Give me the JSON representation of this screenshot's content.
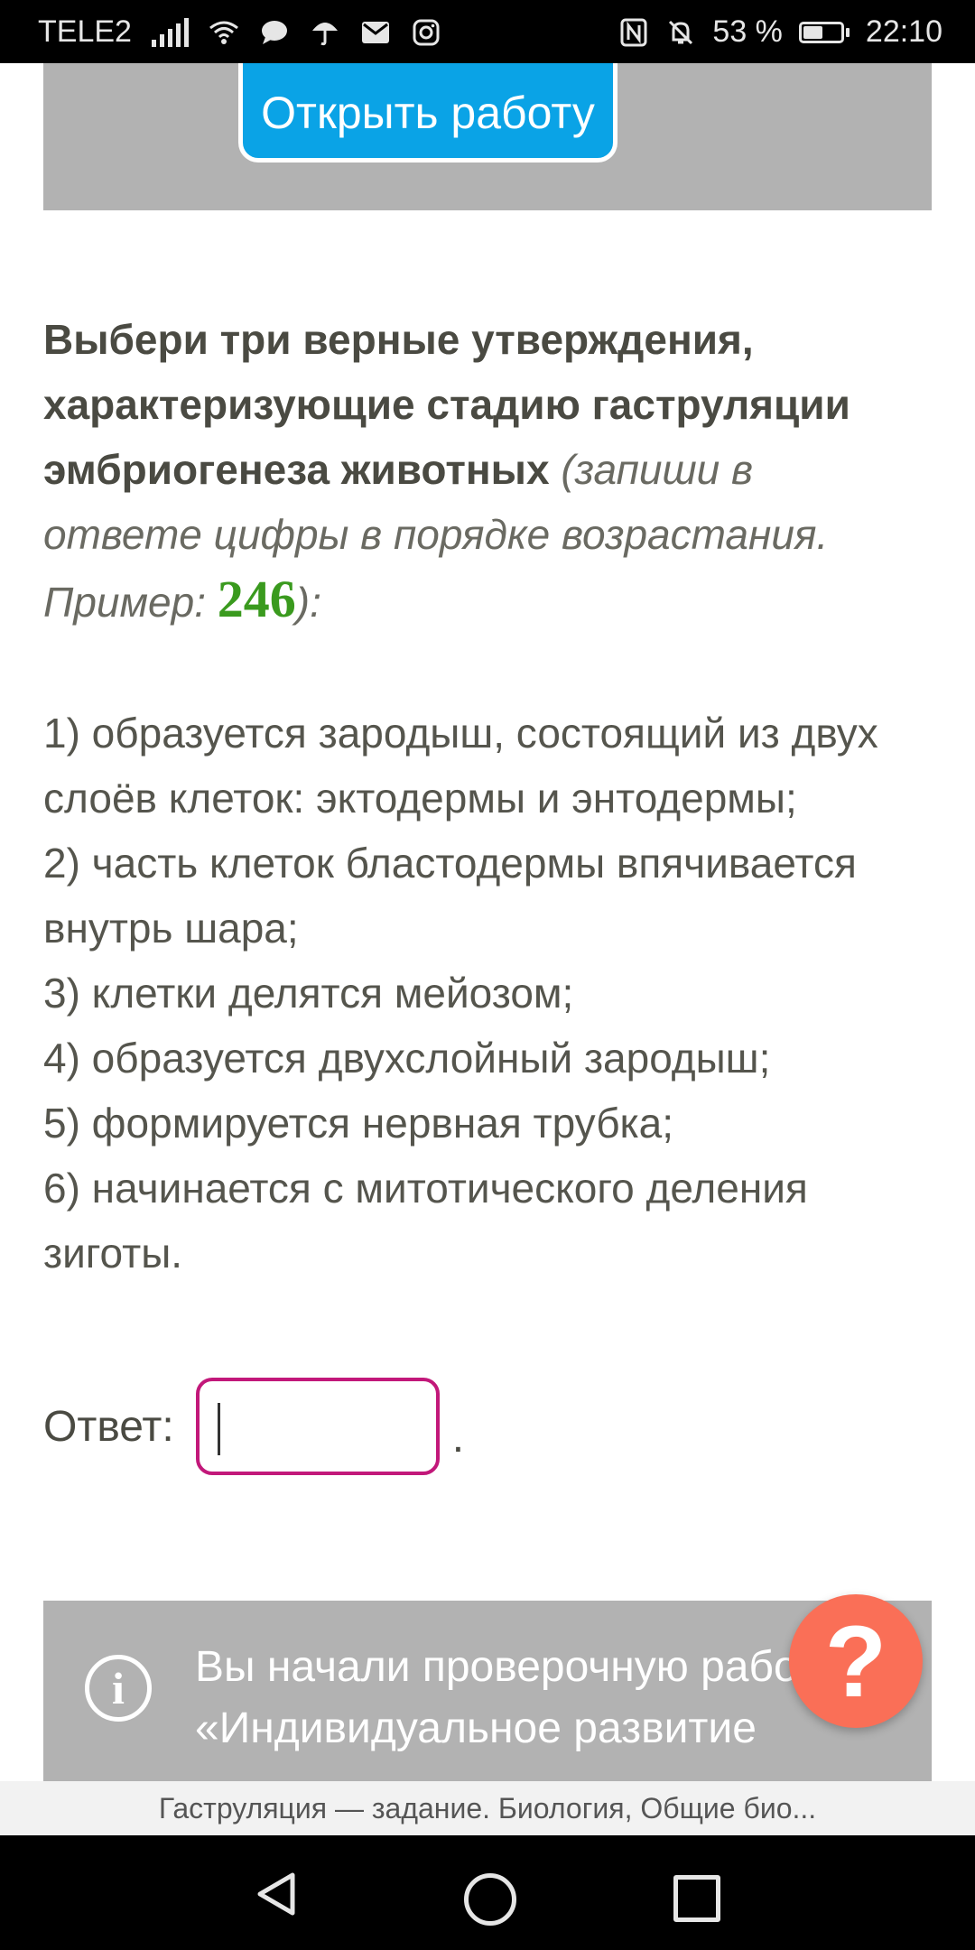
{
  "status_bar": {
    "carrier": "TELE2",
    "battery": "53 %",
    "battery_level": 0.53,
    "time": "22:10",
    "icons": [
      "signal-icon",
      "wifi-icon",
      "message-icon",
      "umbrella-icon",
      "mail-icon",
      "instagram-icon",
      "nfc-icon",
      "mute-icon",
      "battery-icon"
    ]
  },
  "top_banner": {
    "button_label": "Открыть работу"
  },
  "question": {
    "prompt": "Выбери три верные утверждения, характеризующие стадию гаструляции эмбриогенеза животных",
    "hint": "(запиши в ответе цифры в порядке возрастания. Пример: ",
    "example": "246",
    "closing": "):"
  },
  "options": [
    "1) образуется зародыш, состоящий из двух слоёв клеток: эктодермы и энтодермы;",
    "2) часть клеток бластодермы впячивается внутрь шара;",
    "3) клетки делятся мейозом;",
    "4) образуется двухслойный зародыш;",
    "5) формируется нервная трубка;",
    "6) начинается с митотического деления зиготы."
  ],
  "answer": {
    "label": "Ответ:",
    "value": "",
    "suffix": "."
  },
  "info_banner": {
    "text": "Вы начали проверочную работу «Индивидуальное развитие"
  },
  "help_button": {
    "label": "?"
  },
  "page_title": "Гаструляция — задание. Биология, Общие био..."
}
